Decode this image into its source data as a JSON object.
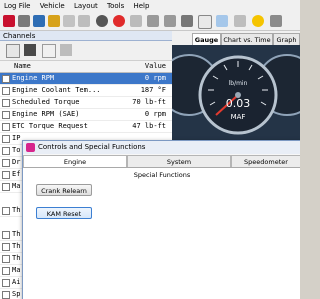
{
  "menu": [
    "Log File",
    "Vehicle",
    "Layout",
    "Tools",
    "Help"
  ],
  "channels": {
    "title": "Channels",
    "col_name": "Name",
    "col_value": "Value",
    "rows": [
      {
        "name": "Engine RPM",
        "value": "0 rpm",
        "selected": true
      },
      {
        "name": "Engine Coolant Tem...",
        "value": "187 °F",
        "selected": false
      },
      {
        "name": "Scheduled Torque",
        "value": "70 lb-ft",
        "selected": false
      },
      {
        "name": "Engine RPM (SAE)",
        "value": "0 rpm",
        "selected": false
      },
      {
        "name": "ETC Torque Request",
        "value": "47 lb-ft",
        "selected": false
      },
      {
        "name": "IP",
        "value": "",
        "selected": false
      },
      {
        "name": "To",
        "value": "",
        "selected": false
      },
      {
        "name": "Dr",
        "value": "",
        "selected": false
      },
      {
        "name": "Ef",
        "value": "",
        "selected": false
      },
      {
        "name": "Ma",
        "value": "",
        "selected": false
      },
      {
        "name": "Th",
        "value": "",
        "selected": false
      }
    ],
    "lower_rows": [
      "Th",
      "Th",
      "Th",
      "Ma",
      "Ai",
      "Sp"
    ]
  },
  "view_tabs": [
    "Gauge",
    "Chart vs. Time",
    "Graph"
  ],
  "gauge": {
    "label": "MAF",
    "value": "0.03",
    "unit": "lb/min"
  },
  "dialog": {
    "title": "Controls and Special Functions",
    "tabs": [
      "Engine",
      "System",
      "Speedometer"
    ],
    "section": "Special Functions",
    "buttons": [
      "Crank Relearn",
      "KAM Reset"
    ]
  }
}
